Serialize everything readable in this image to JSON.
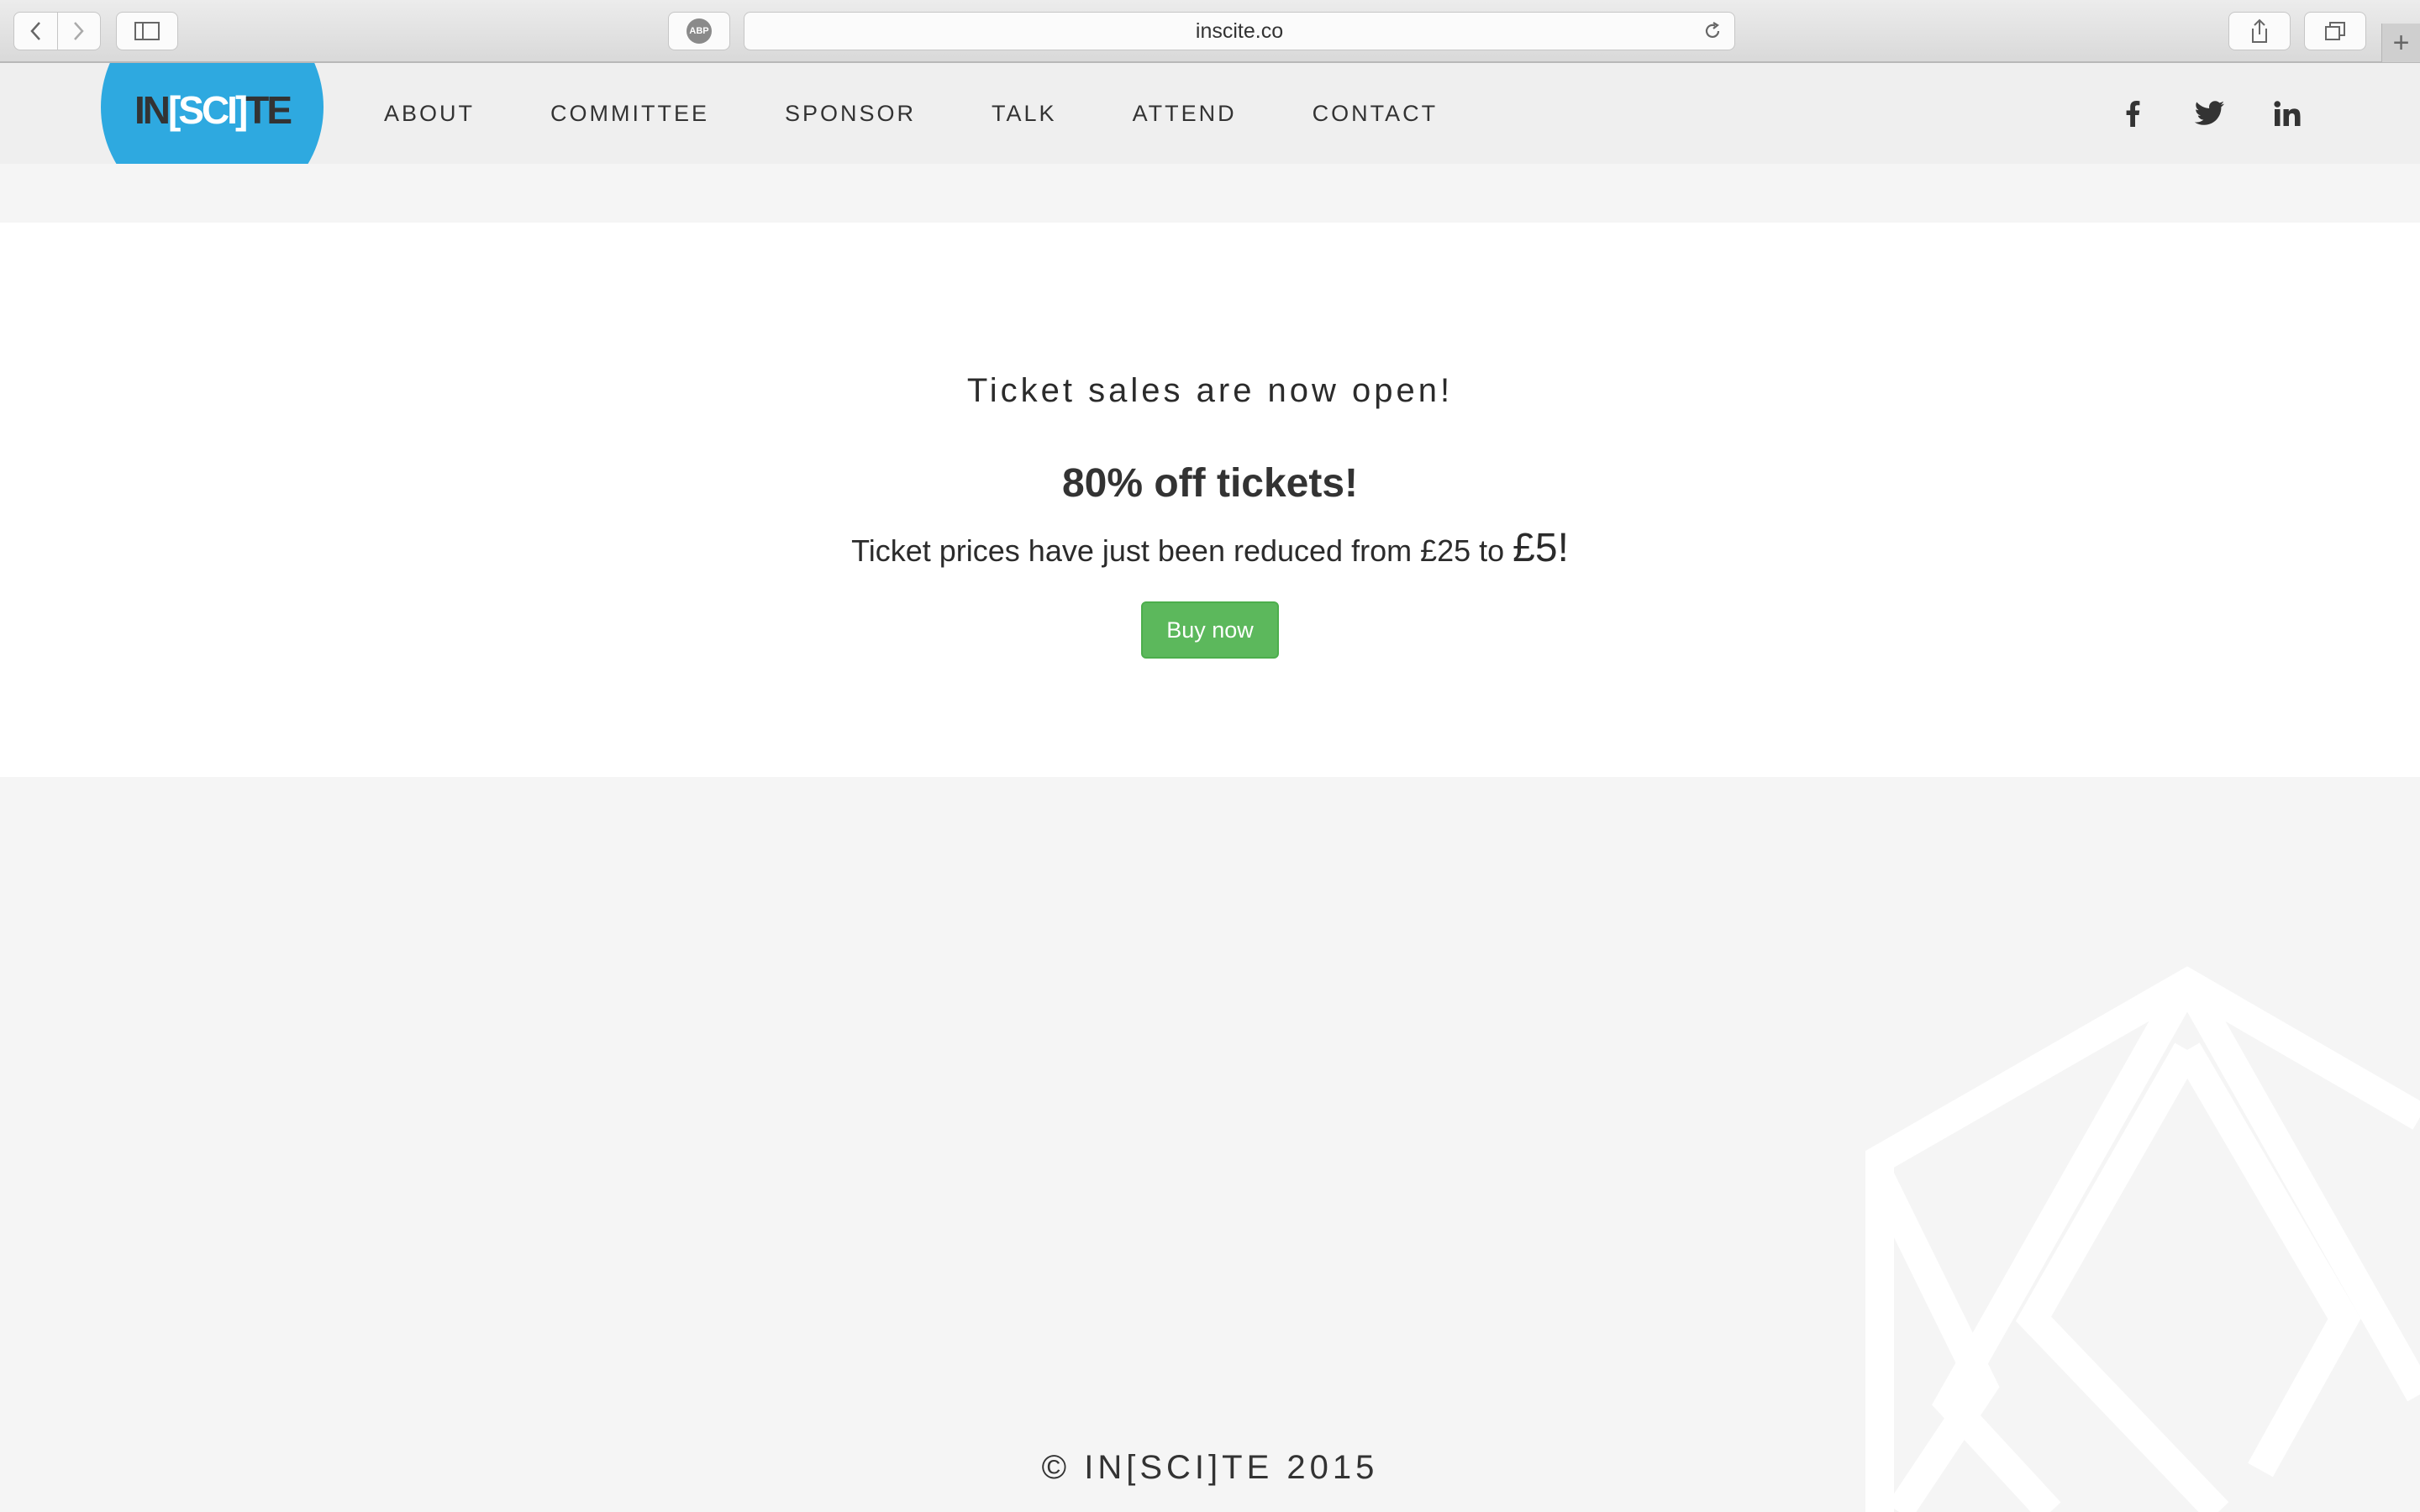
{
  "browser": {
    "url": "inscite.co",
    "adblock_label": "ABP",
    "new_tab_label": "+"
  },
  "site": {
    "logo": {
      "part1": "IN",
      "part2": "[SCI]",
      "part3": "TE"
    },
    "menu": [
      {
        "label": "ABOUT"
      },
      {
        "label": "COMMITTEE"
      },
      {
        "label": "SPONSOR"
      },
      {
        "label": "TALK"
      },
      {
        "label": "ATTEND"
      },
      {
        "label": "CONTACT"
      }
    ],
    "social": [
      "facebook-icon",
      "twitter-icon",
      "linkedin-icon"
    ]
  },
  "banner": {
    "headline": "Ticket sales are now open!",
    "offer": "80% off tickets!",
    "description_prefix": "Ticket prices have just been reduced from £25 to ",
    "new_price": "£5!",
    "button": "Buy now"
  },
  "footer": {
    "copyright": "© IN[SCI]TE 2015"
  },
  "colors": {
    "brand_blue": "#2ea9e0",
    "button_green": "#5cb85c",
    "background": "#f5f5f5"
  }
}
